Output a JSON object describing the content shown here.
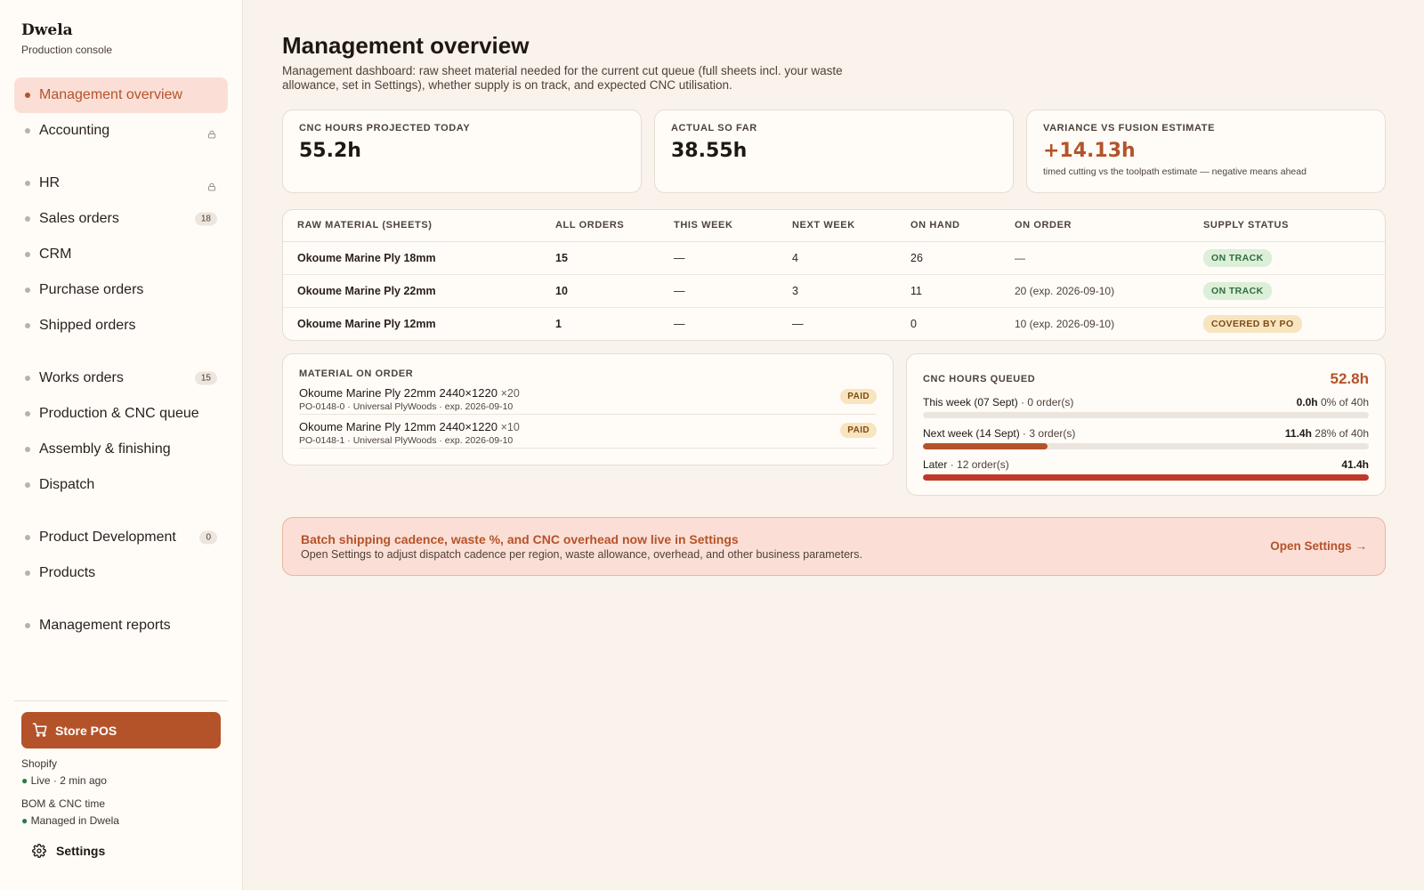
{
  "brand": {
    "name": "Dwela",
    "subtitle": "Production console"
  },
  "sidebar": {
    "groups": [
      [
        {
          "label": "Management overview",
          "active": true
        },
        {
          "label": "Accounting",
          "locked": true
        }
      ],
      [
        {
          "label": "HR",
          "locked": true
        },
        {
          "label": "Sales orders",
          "badge": "18"
        },
        {
          "label": "CRM"
        },
        {
          "label": "Purchase orders"
        },
        {
          "label": "Shipped orders"
        }
      ],
      [
        {
          "label": "Works orders",
          "badge": "15"
        },
        {
          "label": "Production & CNC queue"
        },
        {
          "label": "Assembly & finishing"
        },
        {
          "label": "Dispatch"
        }
      ],
      [
        {
          "label": "Product Development",
          "badge": "0"
        },
        {
          "label": "Products"
        }
      ],
      [
        {
          "label": "Management reports"
        }
      ]
    ],
    "pos_button": "Store POS",
    "integrations": [
      {
        "name": "Shopify",
        "status": "● Live · 2 min ago"
      },
      {
        "name": "BOM & CNC time",
        "status": "● Managed in Dwela"
      }
    ],
    "settings_label": "Settings"
  },
  "header": {
    "title": "Management overview",
    "description": "Management dashboard: raw sheet material needed for the current cut queue (full sheets incl. your waste allowance, set in Settings), whether supply is on track, and expected CNC utilisation."
  },
  "stats": [
    {
      "label": "CNC HOURS PROJECTED TODAY",
      "value": "55.2h"
    },
    {
      "label": "ACTUAL SO FAR",
      "value": "38.55h"
    },
    {
      "label": "VARIANCE VS FUSION ESTIMATE",
      "value": "+14.13h",
      "note": "timed cutting vs the toolpath estimate — negative means ahead"
    }
  ],
  "materials_table": {
    "columns": [
      "RAW MATERIAL (SHEETS)",
      "ALL ORDERS",
      "THIS WEEK",
      "NEXT WEEK",
      "ON HAND",
      "ON ORDER",
      "SUPPLY STATUS"
    ],
    "rows": [
      {
        "material": "Okoume Marine Ply 18mm",
        "all": "15",
        "this_week": "—",
        "next_week": "4",
        "on_hand": "26",
        "on_order": "—",
        "status": "ON TRACK",
        "status_kind": "green"
      },
      {
        "material": "Okoume Marine Ply 22mm",
        "all": "10",
        "this_week": "—",
        "next_week": "3",
        "on_hand": "11",
        "on_order": "20 (exp. 2026-09-10)",
        "status": "ON TRACK",
        "status_kind": "green"
      },
      {
        "material": "Okoume Marine Ply 12mm",
        "all": "1",
        "this_week": "—",
        "next_week": "—",
        "on_hand": "0",
        "on_order": "10 (exp. 2026-09-10)",
        "status": "COVERED BY PO",
        "status_kind": "amber"
      }
    ]
  },
  "material_on_order": {
    "label": "MATERIAL ON ORDER",
    "items": [
      {
        "name": "Okoume Marine Ply 22mm 2440×1220",
        "qty": "×20",
        "detail": "PO-0148-0 · Universal PlyWoods · exp. 2026-09-10",
        "status": "PAID"
      },
      {
        "name": "Okoume Marine Ply 12mm 2440×1220",
        "qty": "×10",
        "detail": "PO-0148-1 · Universal PlyWoods · exp. 2026-09-10",
        "status": "PAID"
      }
    ]
  },
  "cnc_queue": {
    "label": "CNC HOURS QUEUED",
    "total": "52.8h",
    "rows": [
      {
        "period": "This week (07 Sept)",
        "orders": " · 0 order(s)",
        "hours": "0.0h",
        "pct": " 0% of 40h",
        "fill": 0.0,
        "color": "#b4532a"
      },
      {
        "period": "Next week (14 Sept)",
        "orders": " · 3 order(s)",
        "hours": "11.4h",
        "pct": " 28% of 40h",
        "fill": 0.28,
        "color": "#b4532a"
      },
      {
        "period": "Later",
        "orders": " · 12 order(s)",
        "hours": "41.4h",
        "pct": "",
        "fill": 1.0,
        "color": "#c0392b"
      }
    ]
  },
  "banner": {
    "title": "Batch shipping cadence, waste %, and CNC overhead now live in Settings",
    "body": "Open Settings to adjust dispatch cadence per region, waste allowance, overhead, and other business parameters.",
    "link": "Open Settings →"
  }
}
